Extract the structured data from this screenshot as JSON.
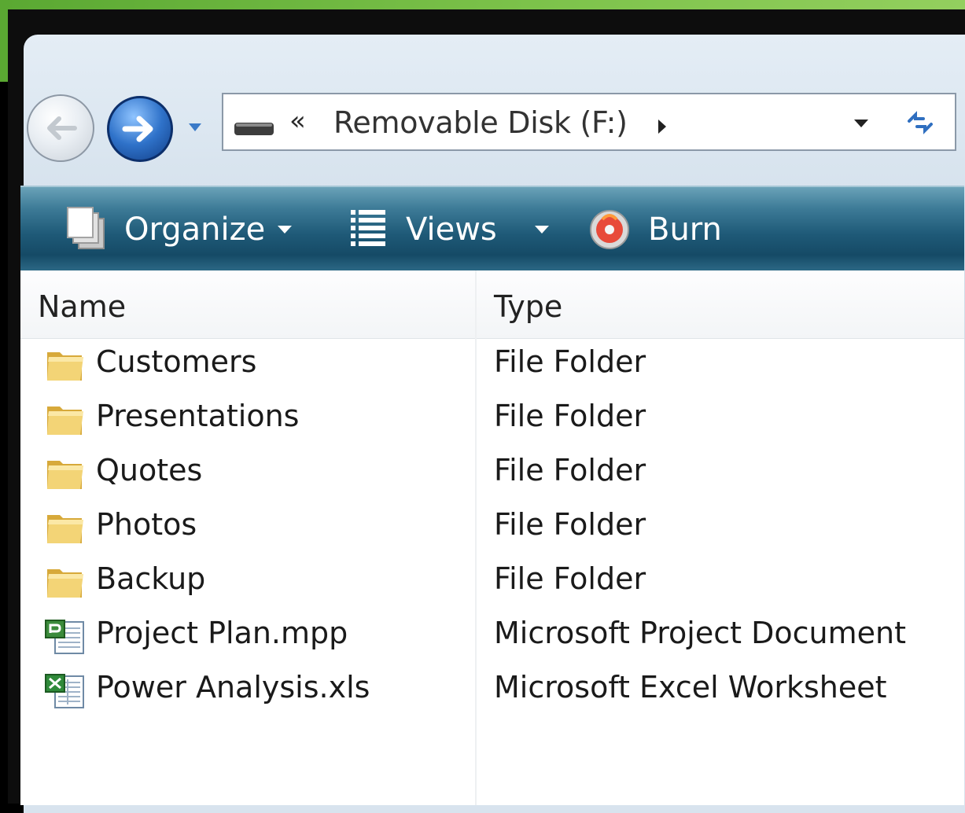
{
  "address_bar": {
    "overflow_chevron": "«",
    "path_label": "Removable Disk (F:)"
  },
  "toolbar": {
    "organize_label": "Organize",
    "views_label": "Views",
    "burn_label": "Burn"
  },
  "columns": {
    "name_label": "Name",
    "type_label": "Type"
  },
  "files": [
    {
      "name": "Customers",
      "type": "File Folder",
      "icon": "folder-icon"
    },
    {
      "name": "Presentations",
      "type": "File Folder",
      "icon": "folder-icon"
    },
    {
      "name": "Quotes",
      "type": "File Folder",
      "icon": "folder-icon"
    },
    {
      "name": "Photos",
      "type": "File Folder",
      "icon": "folder-icon"
    },
    {
      "name": "Backup",
      "type": "File Folder",
      "icon": "folder-icon"
    },
    {
      "name": "Project Plan.mpp",
      "type": "Microsoft Project Document",
      "icon": "project-file-icon"
    },
    {
      "name": "Power Analysis.xls",
      "type": "Microsoft Excel Worksheet",
      "icon": "excel-file-icon"
    }
  ],
  "colors": {
    "slide_green": "#7cc24a",
    "toolbar_teal": "#1f5a78",
    "nav_forward_blue": "#2f72c9"
  }
}
